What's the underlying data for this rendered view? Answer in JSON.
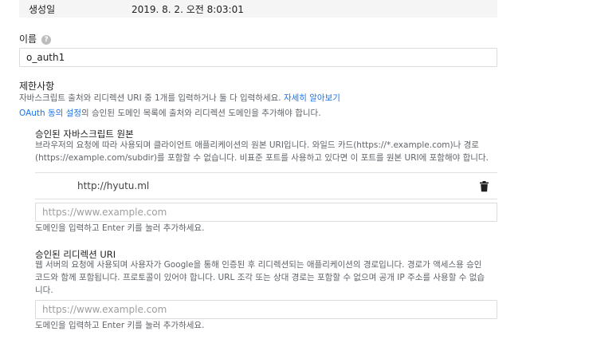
{
  "created": {
    "label": "생성일",
    "value": "2019. 8. 2. 오전 8:03:01"
  },
  "name_field": {
    "label": "이름",
    "help_icon": "help-icon",
    "value": "o_auth1"
  },
  "restrictions": {
    "title": "제한사항",
    "description": "자바스크립트 출처와 리디렉션 URI 중 1개를 입력하거나 둘 다 입력하세요. ",
    "learn_more": "자세히 알아보기",
    "consent_link": "OAuth 동의 설정",
    "consent_suffix": "의 승인된 도메인 목록에 출처와 리디렉션 도메인을 추가해야 합니다."
  },
  "js_origins": {
    "title": "승인된 자바스크립트 원본",
    "description_line1": "브라우저의 요청에 따라 사용되며 클라이언트 애플리케이션의 원본 URI입니다. 와일드 카드(https://*.example.com)나 경로",
    "description_line2": "(https://example.com/subdir)를 포함할 수 없습니다. 비표준 포트를 사용하고 있다면 이 포트를 원본 URI에 포함해야 합니다.",
    "existing_uri": "http://hyutu.ml",
    "delete_icon": "trash-icon",
    "placeholder": "https://www.example.com",
    "hint": "도메인을 입력하고 Enter 키를 눌러 추가하세요."
  },
  "redirect_uris": {
    "title": "승인된 리디렉션 URI",
    "description_line1": "웹 서버의 요청에 사용되며 사용자가 Google을 통해 인증된 후 리디렉션되는 애플리케이션의 경로입니다. 경로가 액세스용 승인",
    "description_line2": "코드와 함께 포함됩니다. 프로토콜이 있어야 합니다. URL 조각 또는 상대 경로는 포함할 수 없으며 공개 IP 주소를 사용할 수 없습",
    "description_line3": "니다.",
    "placeholder": "https://www.example.com",
    "hint": "도메인을 입력하고 Enter 키를 눌러 추가하세요."
  }
}
